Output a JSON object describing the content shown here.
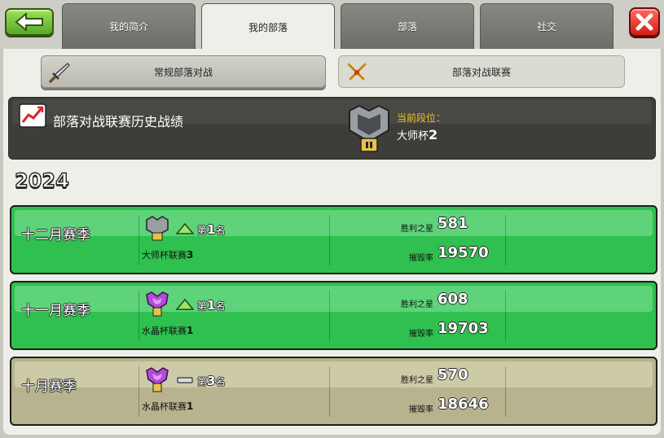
{
  "tabs": [
    {
      "label": "我的简介",
      "active": false
    },
    {
      "label": "我的部落",
      "active": true
    },
    {
      "label": "部落",
      "active": false
    },
    {
      "label": "社交",
      "active": false
    }
  ],
  "subtabs": {
    "regular_war": "常规部落对战",
    "war_league": "部落对战联赛"
  },
  "history": {
    "title": "部落对战联赛历史战绩",
    "current_rank_label": "当前段位：",
    "current_rank_name": "大师杯",
    "current_rank_tier": "2"
  },
  "year": "2024",
  "seasons": [
    {
      "name": "十二月赛季",
      "change": "up",
      "place_prefix": "第",
      "place_num": "1",
      "place_suffix": "名",
      "league": "大师杯联赛",
      "league_tier": "3",
      "stars_label": "胜利之星",
      "stars": "581",
      "destruction_label": "摧毁率",
      "destruction": "19570",
      "color": "green"
    },
    {
      "name": "十一月赛季",
      "change": "up",
      "place_prefix": "第",
      "place_num": "1",
      "place_suffix": "名",
      "league": "水晶杯联赛",
      "league_tier": "1",
      "stars_label": "胜利之星",
      "stars": "608",
      "destruction_label": "摧毁率",
      "destruction": "19703",
      "color": "green"
    },
    {
      "name": "十月赛季",
      "change": "same",
      "place_prefix": "第",
      "place_num": "3",
      "place_suffix": "名",
      "league": "水晶杯联赛",
      "league_tier": "1",
      "stars_label": "胜利之星",
      "stars": "570",
      "destruction_label": "摧毁率",
      "destruction": "18646",
      "color": "tan"
    }
  ],
  "colors": {
    "green_row": "#2fc04f",
    "tan_row": "#b6b38e",
    "rank_gold": "#f3c21e"
  },
  "icons": {
    "back": "back-arrow-icon",
    "close": "close-x-icon",
    "sword": "sword-icon",
    "crossed_swords": "crossed-swords-icon",
    "chart": "chart-icon",
    "master_league": "master-league-icon",
    "crystal_league": "crystal-league-icon",
    "rank_up": "rank-up-icon",
    "rank_same": "rank-same-icon"
  }
}
